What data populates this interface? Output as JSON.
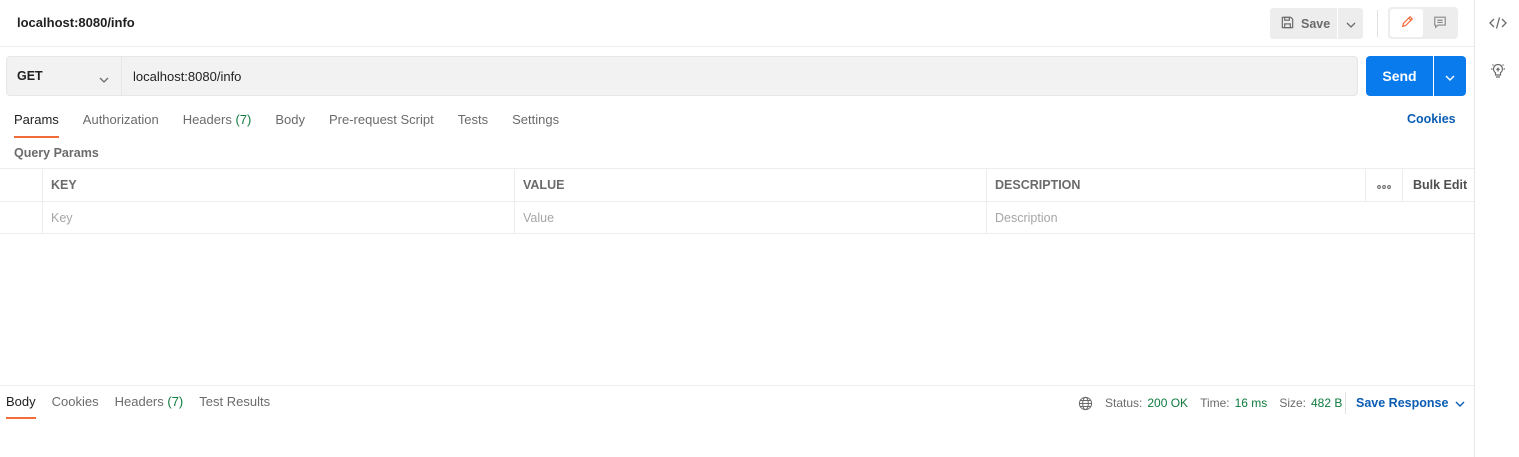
{
  "request": {
    "title": "localhost:8080/info",
    "method": "GET",
    "url": "localhost:8080/info"
  },
  "header": {
    "save_label": "Save"
  },
  "send": {
    "label": "Send"
  },
  "request_tabs": {
    "params": "Params",
    "authorization": "Authorization",
    "headers": "Headers",
    "headers_count": "(7)",
    "body": "Body",
    "prerequest": "Pre-request Script",
    "tests": "Tests",
    "settings": "Settings",
    "active": "Params"
  },
  "cookies_label": "Cookies",
  "query_params": {
    "title": "Query Params",
    "columns": {
      "key": "KEY",
      "value": "VALUE",
      "description": "DESCRIPTION"
    },
    "bulk_edit": "Bulk Edit",
    "placeholders": {
      "key": "Key",
      "value": "Value",
      "description": "Description"
    }
  },
  "response": {
    "tabs": {
      "body": "Body",
      "cookies": "Cookies",
      "headers": "Headers",
      "headers_count": "(7)",
      "test_results": "Test Results",
      "active": "Body"
    },
    "status_label": "Status:",
    "status_value": "200 OK",
    "time_label": "Time:",
    "time_value": "16 ms",
    "size_label": "Size:",
    "size_value": "482 B",
    "save_response": "Save Response"
  },
  "colors": {
    "accent_orange": "#f26b3a",
    "send_blue": "#097bed",
    "link_blue": "#0b5cb3",
    "status_green": "#0f7a3e"
  },
  "icons": {
    "save": "floppy-disk-icon",
    "edit_mode": "pencil-icon",
    "comments_mode": "comment-icon",
    "code": "code-icon",
    "info": "lightbulb-icon",
    "globe": "globe-icon"
  }
}
